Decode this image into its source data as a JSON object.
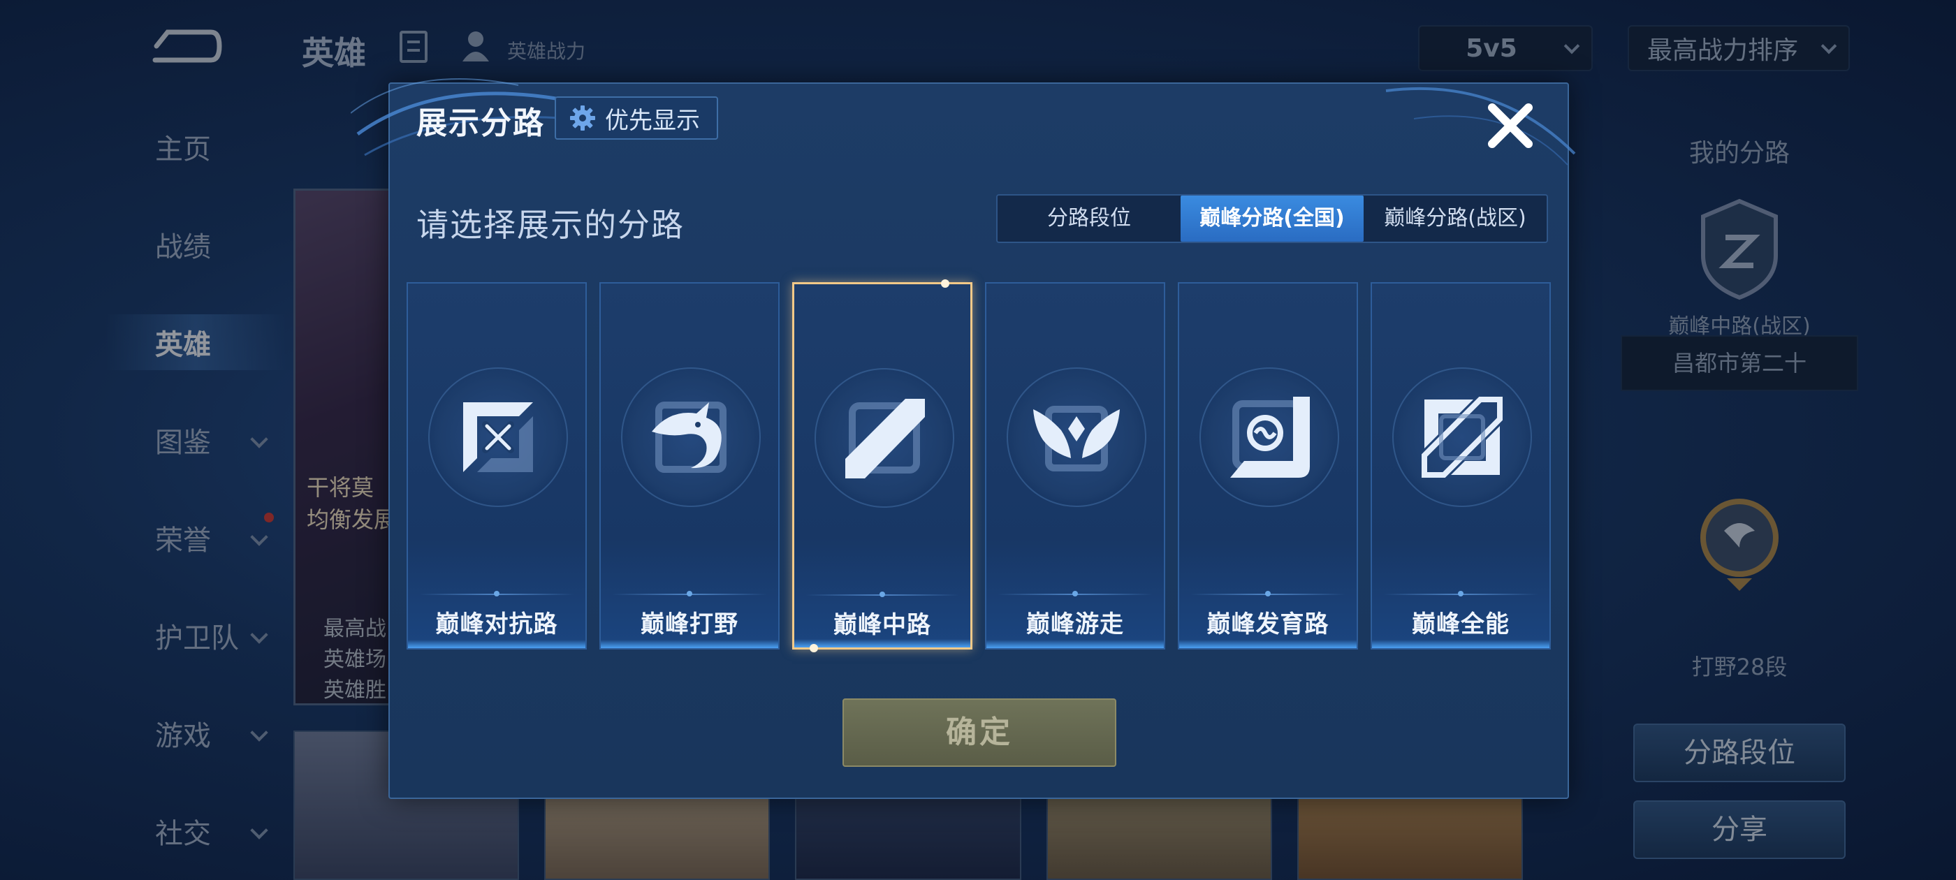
{
  "background": {
    "topbar": {
      "title": "英雄",
      "power_label": "英雄战力",
      "mode_select": "5v5",
      "sort_select": "最高战力排序"
    },
    "sidenav": [
      {
        "label": "主页"
      },
      {
        "label": "战绩"
      },
      {
        "label": "英雄",
        "active": true
      },
      {
        "label": "图鉴",
        "chevron": true
      },
      {
        "label": "荣誉",
        "chevron": true,
        "dot": true
      },
      {
        "label": "护卫队",
        "chevron": true
      },
      {
        "label": "游戏",
        "chevron": true
      },
      {
        "label": "社交",
        "chevron": true
      }
    ],
    "hero_card": {
      "line1": "干将莫",
      "line2": "均衡发展",
      "stats": [
        "最高战",
        "英雄场",
        "英雄胜"
      ]
    },
    "right_panel": {
      "title": "我的分路",
      "lane": "巅峰中路(战区)",
      "city": "昌都市第二十",
      "rank": "打野28段",
      "btn_lane_rank": "分路段位",
      "btn_share": "分享"
    }
  },
  "modal": {
    "title": "展示分路",
    "priority_button": "优先显示",
    "subtitle": "请选择展示的分路",
    "segments": [
      {
        "label": "分路段位",
        "active": false
      },
      {
        "label": "巅峰分路(全国)",
        "active": true
      },
      {
        "label": "巅峰分路(战区)",
        "active": false
      }
    ],
    "lanes": [
      {
        "name": "巅峰对抗路",
        "icon": "sword-cross-icon",
        "selected": false
      },
      {
        "name": "巅峰打野",
        "icon": "dragon-icon",
        "selected": false
      },
      {
        "name": "巅峰中路",
        "icon": "mid-lane-slash-icon",
        "selected": true
      },
      {
        "name": "巅峰游走",
        "icon": "wings-icon",
        "selected": false
      },
      {
        "name": "巅峰发育路",
        "icon": "target-icon",
        "selected": false
      },
      {
        "name": "巅峰全能",
        "icon": "all-round-icon",
        "selected": false
      }
    ],
    "confirm_label": "确定"
  },
  "colors": {
    "accent_blue": "#2a6cc2",
    "selected_border": "#f2c988",
    "panel_bg": "#1b3a62"
  }
}
